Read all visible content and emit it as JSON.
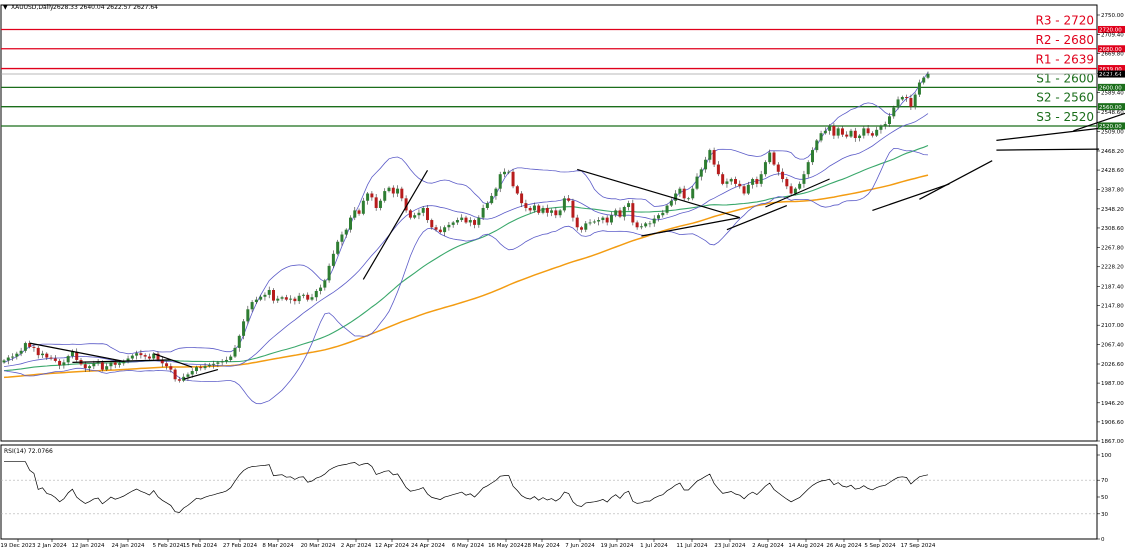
{
  "header": {
    "caret": "▼",
    "symbol": "XAUUSD,Daily",
    "ohlc": "2628.33 2640.04 2622.57 2627.64"
  },
  "rsi_header": "RSI(14) 72.0766",
  "colors": {
    "candle_up": "#2e7d32",
    "candle_down": "#b71c1c",
    "resistance": "#e0001b",
    "support": "#1b6e1b",
    "bb": "#5c5cc8",
    "ma_green": "#3aa86b",
    "ma_orange": "#f39c12",
    "rsi": "#000000",
    "trend": "#000000"
  },
  "chart_data": [
    {
      "type": "candlestick",
      "title": "XAUUSD,Daily",
      "ylim": [
        1867,
        2790
      ],
      "y_ticks": [
        "2750.00",
        "2709.40",
        "2669.80",
        "2629.00",
        "2589.40",
        "2548.60",
        "2509.00",
        "2468.20",
        "2428.60",
        "2387.80",
        "2348.20",
        "2308.60",
        "2267.80",
        "2228.20",
        "2187.40",
        "2147.80",
        "2107.00",
        "2067.40",
        "2026.60",
        "1987.00",
        "1946.20",
        "1906.60",
        "1867.00"
      ],
      "x_ticks": [
        "19 Dec 2023",
        "2 Jan 2024",
        "12 Jan 2024",
        "24 Jan 2024",
        "5 Feb 2024",
        "15 Feb 2024",
        "27 Feb 2024",
        "8 Mar 2024",
        "20 Mar 2024",
        "2 Apr 2024",
        "12 Apr 2024",
        "24 Apr 2024",
        "6 May 2024",
        "16 May 2024",
        "28 May 2024",
        "7 Jun 2024",
        "19 Jun 2024",
        "1 Jul 2024",
        "11 Jul 2024",
        "23 Jul 2024",
        "2 Aug 2024",
        "14 Aug 2024",
        "26 Aug 2024",
        "5 Sep 2024",
        "17 Sep 2024"
      ],
      "current_price": "2627.64",
      "levels": [
        {
          "name": "R3 - 2720",
          "tag": "2720.00",
          "value": 2720,
          "kind": "resistance"
        },
        {
          "name": "R2 - 2680",
          "tag": "2680.00",
          "value": 2680,
          "kind": "resistance"
        },
        {
          "name": "R1 - 2639",
          "tag": "2639.00",
          "value": 2639,
          "kind": "resistance"
        },
        {
          "name": "S1 - 2600",
          "tag": "2600.00",
          "value": 2600,
          "kind": "support"
        },
        {
          "name": "S2 - 2560",
          "tag": "2560.00",
          "value": 2560,
          "kind": "support"
        },
        {
          "name": "S3 - 2520",
          "tag": "2520.00",
          "value": 2520,
          "kind": "support"
        }
      ],
      "closes": [
        2034,
        2040,
        2042,
        2048,
        2054,
        2070,
        2062,
        2060,
        2045,
        2048,
        2040,
        2038,
        2033,
        2024,
        2030,
        2043,
        2052,
        2035,
        2026,
        2018,
        2022,
        2028,
        2030,
        2015,
        2022,
        2030,
        2025,
        2028,
        2032,
        2038,
        2044,
        2049,
        2045,
        2042,
        2038,
        2048,
        2036,
        2028,
        2022,
        2015,
        1995,
        1992,
        2000,
        2005,
        2012,
        2020,
        2018,
        2022,
        2025,
        2027,
        2030,
        2032,
        2035,
        2042,
        2060,
        2085,
        2115,
        2140,
        2155,
        2160,
        2166,
        2170,
        2180,
        2158,
        2162,
        2165,
        2160,
        2162,
        2157,
        2168,
        2170,
        2160,
        2165,
        2178,
        2185,
        2200,
        2230,
        2255,
        2280,
        2295,
        2305,
        2330,
        2345,
        2338,
        2365,
        2380,
        2372,
        2350,
        2365,
        2385,
        2392,
        2380,
        2390,
        2370,
        2345,
        2330,
        2335,
        2340,
        2350,
        2325,
        2310,
        2305,
        2300,
        2310,
        2315,
        2320,
        2325,
        2330,
        2320,
        2325,
        2315,
        2330,
        2350,
        2360,
        2375,
        2390,
        2420,
        2425,
        2425,
        2395,
        2380,
        2360,
        2350,
        2345,
        2355,
        2340,
        2350,
        2340,
        2345,
        2335,
        2345,
        2370,
        2365,
        2330,
        2310,
        2305,
        2318,
        2320,
        2322,
        2325,
        2330,
        2320,
        2335,
        2345,
        2332,
        2352,
        2360,
        2320,
        2310,
        2312,
        2318,
        2318,
        2328,
        2335,
        2340,
        2355,
        2365,
        2380,
        2390,
        2370,
        2370,
        2390,
        2415,
        2430,
        2450,
        2470,
        2440,
        2420,
        2400,
        2405,
        2410,
        2400,
        2395,
        2380,
        2398,
        2410,
        2400,
        2420,
        2445,
        2465,
        2440,
        2425,
        2410,
        2395,
        2380,
        2390,
        2400,
        2420,
        2445,
        2470,
        2490,
        2505,
        2510,
        2520,
        2500,
        2515,
        2502,
        2498,
        2510,
        2495,
        2500,
        2515,
        2505,
        2500,
        2512,
        2520,
        2524,
        2540,
        2558,
        2575,
        2580,
        2578,
        2560,
        2585,
        2610,
        2620,
        2628
      ]
    },
    {
      "type": "line",
      "title": "RSI(14) 72.0766",
      "ylim": [
        0,
        100
      ],
      "y_ticks": [
        "100",
        "70",
        "50",
        "30",
        "0"
      ],
      "levels": [
        70,
        30
      ]
    }
  ]
}
